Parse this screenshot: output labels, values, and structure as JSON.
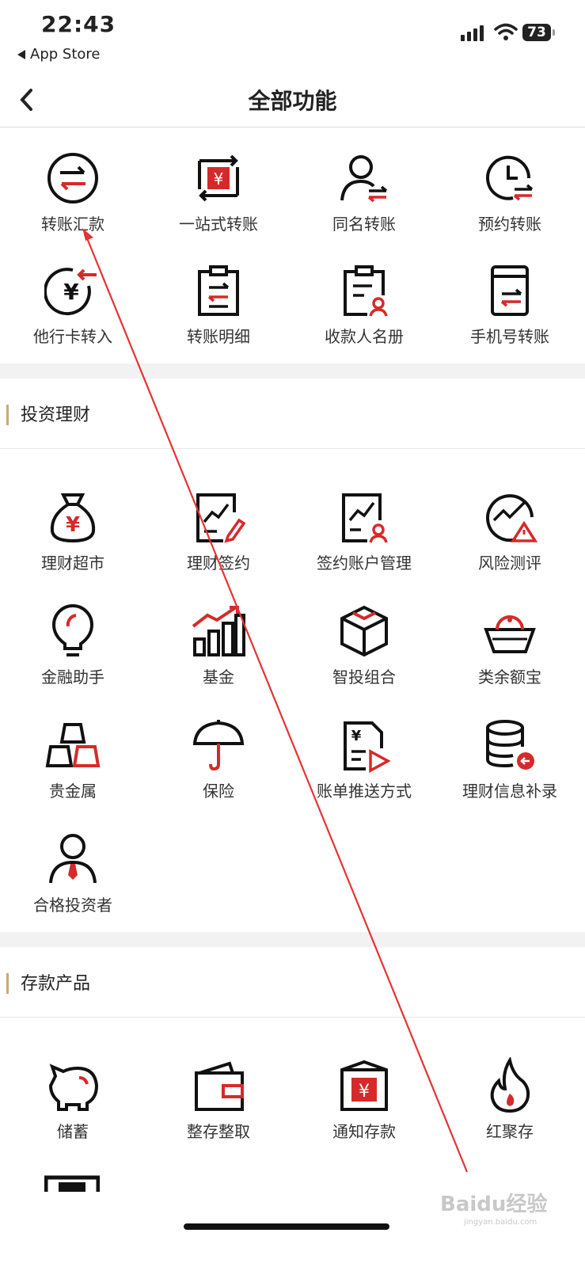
{
  "status_bar": {
    "time": "22:43",
    "back_app": "App Store",
    "battery": "73"
  },
  "nav": {
    "title": "全部功能"
  },
  "transfer": {
    "items": [
      {
        "label": "转账汇款",
        "icon": "exchange-circle-icon"
      },
      {
        "label": "一站式转账",
        "icon": "yuan-cycle-icon"
      },
      {
        "label": "同名转账",
        "icon": "person-transfer-icon"
      },
      {
        "label": "预约转账",
        "icon": "clock-transfer-icon"
      },
      {
        "label": "他行卡转入",
        "icon": "yuan-incoming-icon"
      },
      {
        "label": "转账明细",
        "icon": "clipboard-transfer-icon"
      },
      {
        "label": "收款人名册",
        "icon": "clipboard-person-icon"
      },
      {
        "label": "手机号转账",
        "icon": "phone-transfer-icon"
      }
    ]
  },
  "invest": {
    "title": "投资理财",
    "items": [
      {
        "label": "理财超市",
        "icon": "money-bag-icon"
      },
      {
        "label": "理财签约",
        "icon": "contract-pen-icon"
      },
      {
        "label": "签约账户管理",
        "icon": "chart-person-icon"
      },
      {
        "label": "风险测评",
        "icon": "risk-warning-icon"
      },
      {
        "label": "金融助手",
        "icon": "lightbulb-icon"
      },
      {
        "label": "基金",
        "icon": "bar-chart-icon"
      },
      {
        "label": "智投组合",
        "icon": "cube-icon"
      },
      {
        "label": "类余额宝",
        "icon": "ingot-icon"
      },
      {
        "label": "贵金属",
        "icon": "gold-bars-icon"
      },
      {
        "label": "保险",
        "icon": "umbrella-icon"
      },
      {
        "label": "账单推送方式",
        "icon": "bill-send-icon"
      },
      {
        "label": "理财信息补录",
        "icon": "database-icon"
      },
      {
        "label": "合格投资者",
        "icon": "investor-person-icon"
      }
    ]
  },
  "deposit": {
    "title": "存款产品",
    "items": [
      {
        "label": "储蓄",
        "icon": "piggy-bank-icon"
      },
      {
        "label": "整存整取",
        "icon": "wallet-icon"
      },
      {
        "label": "通知存款",
        "icon": "yuan-box-icon"
      },
      {
        "label": "红聚存",
        "icon": "flame-icon"
      }
    ]
  },
  "watermark": {
    "brand": "Baidu经验",
    "url": "jingyan.baidu.com"
  },
  "colors": {
    "accent_red": "#d62a2a",
    "section_bar": "#c9a877"
  }
}
